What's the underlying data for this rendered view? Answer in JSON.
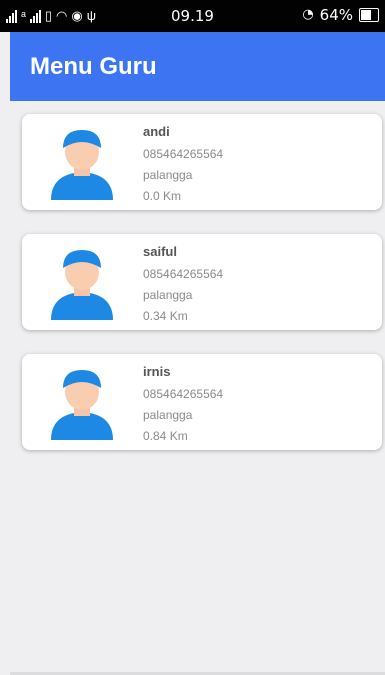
{
  "status_bar": {
    "time": "09.19",
    "battery_percent": "64%",
    "battery_level": 0.64,
    "icons": [
      "signal-icon",
      "signal-icon",
      "sim-icon",
      "notification-icon",
      "wifi-icon",
      "sync-icon",
      "usb-icon",
      "alarm-icon",
      "battery-icon"
    ]
  },
  "app_bar": {
    "title": "Menu Guru",
    "color": "#3c74f2"
  },
  "teachers": [
    {
      "name": "andi",
      "phone": "085464265564",
      "city": "palangga",
      "distance": "0.0 Km"
    },
    {
      "name": "saiful",
      "phone": "085464265564",
      "city": "palangga",
      "distance": "0.34 Km"
    },
    {
      "name": "irnis",
      "phone": "085464265564",
      "city": "palangga",
      "distance": "0.84 Km"
    }
  ],
  "avatar_icon": "teacher-avatar-icon"
}
